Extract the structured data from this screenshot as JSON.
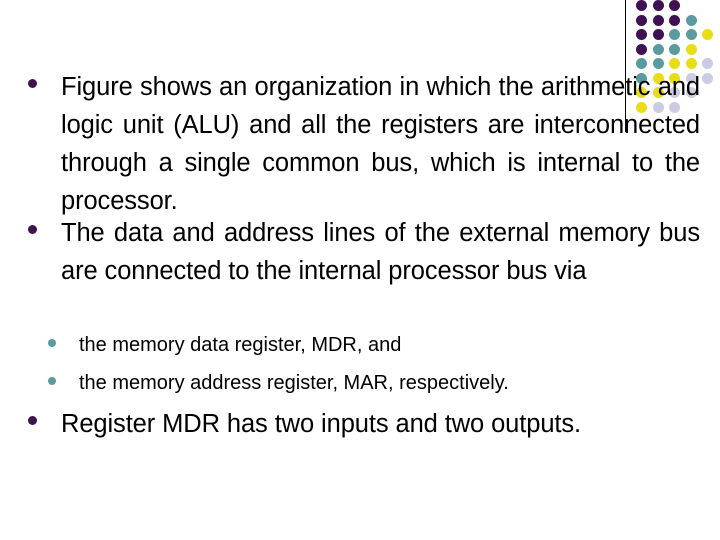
{
  "slide": {
    "background_color": "#ffffff",
    "text_color": "#000000",
    "bullets": [
      {
        "level": 1,
        "marker": "filled-circle",
        "marker_color": "#3D1152",
        "text": "Figure shows an organization in which the arithmetic and logic unit (ALU) and all  the registers are interconnected through a single common bus, which is internal to the  processor."
      },
      {
        "level": 1,
        "marker": "filled-circle",
        "marker_color": "#3D1152",
        "text": "The data and address lines of the external memory bus are connected to the internal processor bus via"
      },
      {
        "level": 2,
        "marker": "filled-circle",
        "marker_color": "#5B9BA0",
        "text": "the memory data register, MDR, and"
      },
      {
        "level": 2,
        "marker": "filled-circle",
        "marker_color": "#5B9BA0",
        "text": "the  memory address register, MAR, respectively."
      },
      {
        "level": 1,
        "marker": "filled-circle",
        "marker_color": "#3D1152",
        "text": "Register MDR has two inputs and two  outputs."
      }
    ]
  },
  "decoration": {
    "name": "corner-dot-grid",
    "colors": {
      "purple": "#3D1152",
      "teal": "#5B9BA0",
      "yellow": "#E8DD17",
      "lavender": "#CCCBE4"
    },
    "rule_color": "#000000",
    "grid": [
      [
        "purple",
        "purple",
        "purple",
        "none",
        "none"
      ],
      [
        "purple",
        "purple",
        "purple",
        "teal",
        "none"
      ],
      [
        "purple",
        "purple",
        "teal",
        "teal",
        "yellow"
      ],
      [
        "purple",
        "teal",
        "teal",
        "yellow",
        "none"
      ],
      [
        "teal",
        "teal",
        "yellow",
        "yellow",
        "lavender"
      ],
      [
        "teal",
        "yellow",
        "yellow",
        "lavender",
        "lavender"
      ],
      [
        "yellow",
        "yellow",
        "lavender",
        "lavender",
        "none"
      ],
      [
        "yellow",
        "lavender",
        "lavender",
        "none",
        "none"
      ]
    ]
  }
}
